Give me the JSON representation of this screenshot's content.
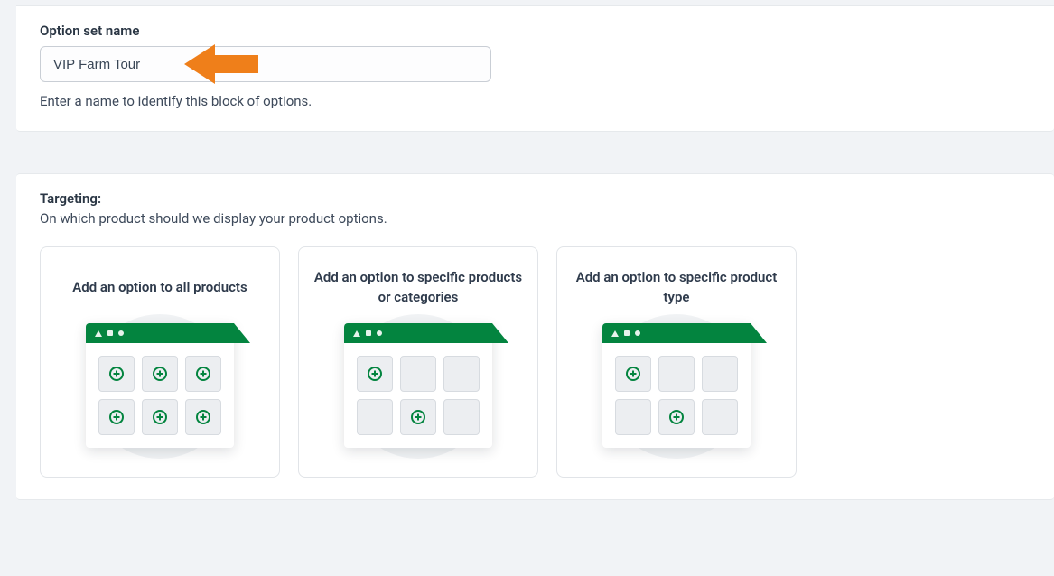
{
  "option_set": {
    "label": "Option set name",
    "value": "VIP Farm Tour",
    "helper": "Enter a name to identify this block of options."
  },
  "targeting": {
    "title": "Targeting:",
    "subtitle": "On which product should we display your product options.",
    "cards": [
      {
        "label": "Add an option to all products",
        "pattern": "all"
      },
      {
        "label": "Add an option to specific products or categories",
        "pattern": "specific"
      },
      {
        "label": "Add an option to specific product type",
        "pattern": "type"
      }
    ]
  },
  "annotation_arrow_color": "#ef7f1a"
}
